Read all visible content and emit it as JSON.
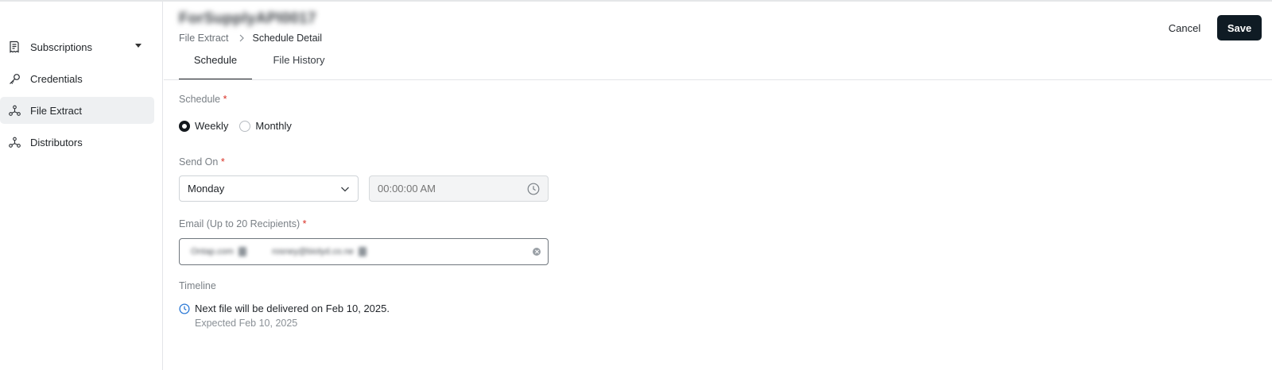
{
  "header": {
    "title": "ForSupplyAPI0017",
    "breadcrumb": {
      "parent": "File Extract",
      "current": "Schedule Detail"
    },
    "cancel_label": "Cancel",
    "save_label": "Save"
  },
  "sidebar": {
    "items": [
      {
        "label": "Subscriptions",
        "icon": "receipt-icon",
        "has_caret": true,
        "active": false
      },
      {
        "label": "Credentials",
        "icon": "key-icon",
        "active": false
      },
      {
        "label": "File Extract",
        "icon": "nodes-icon",
        "active": true
      },
      {
        "label": "Distributors",
        "icon": "nodes-icon",
        "active": false
      }
    ]
  },
  "tabs": [
    {
      "label": "Schedule",
      "active": true
    },
    {
      "label": "File History",
      "active": false
    }
  ],
  "form": {
    "schedule": {
      "label": "Schedule",
      "required_mark": "*",
      "options": [
        {
          "label": "Weekly",
          "checked": true
        },
        {
          "label": "Monthly",
          "checked": false
        }
      ]
    },
    "send_on": {
      "label": "Send On",
      "required_mark": "*",
      "day_value": "Monday",
      "time_placeholder": "00:00:00 AM"
    },
    "email": {
      "label": "Email (Up to 20 Recipients)",
      "required_mark": "*",
      "chips": [
        "Ontap.com",
        "rosney@biolyd.co.ne"
      ]
    },
    "timeline": {
      "label": "Timeline",
      "message": "Next file will be delivered on Feb 10, 2025.",
      "expected": "Expected Feb 10, 2025"
    }
  },
  "colors": {
    "primary_button": "#0f1b24",
    "required": "#d93025",
    "timeline_icon": "#2f7bd6",
    "active_nav_bg": "#eef0f2"
  }
}
